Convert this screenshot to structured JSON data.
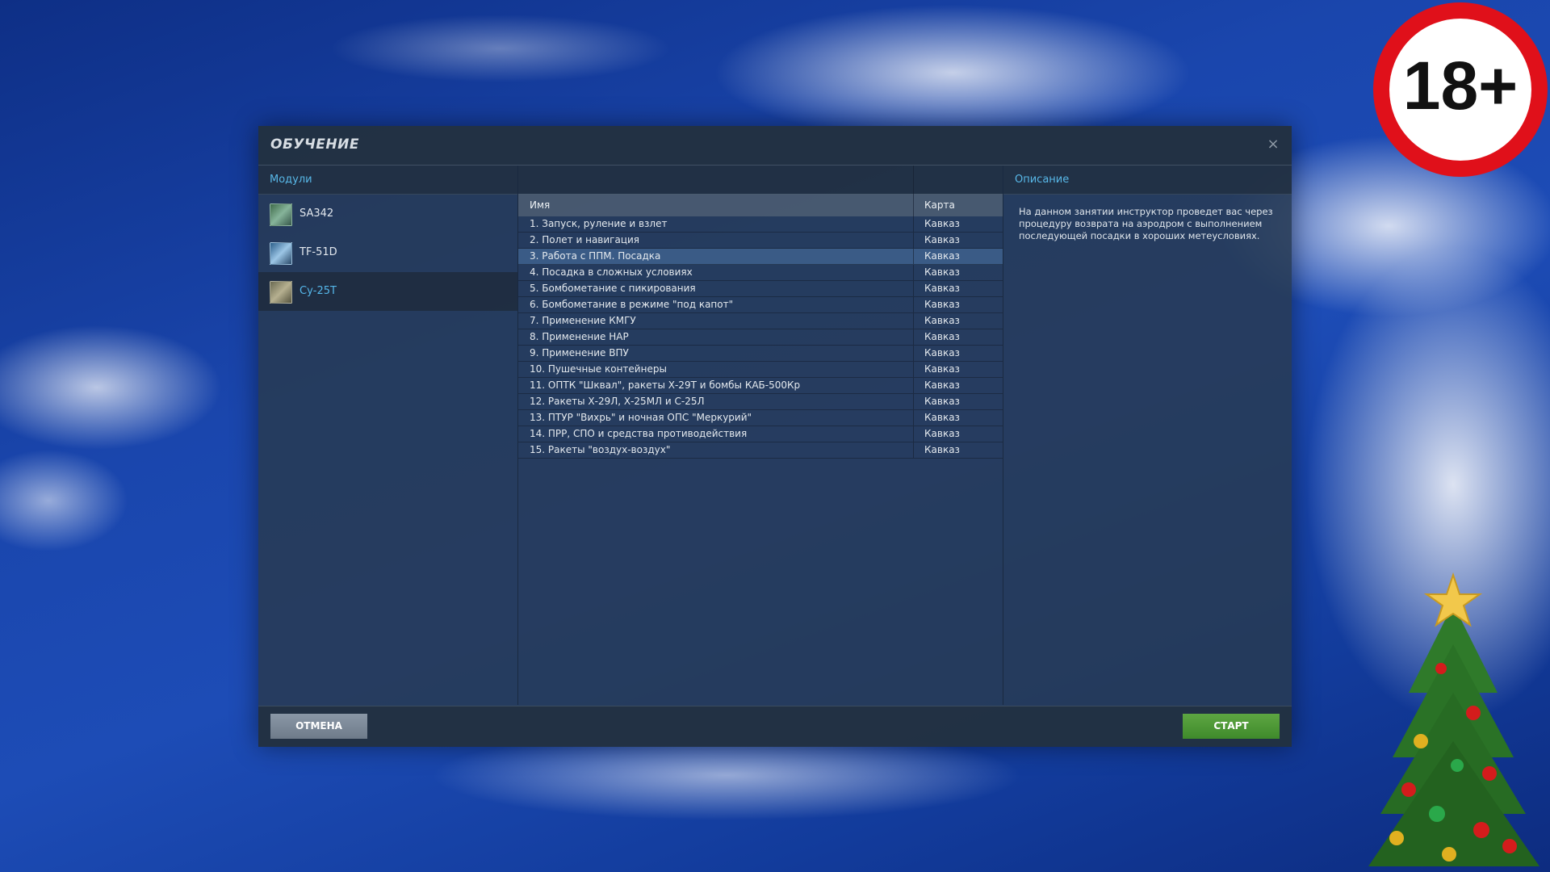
{
  "dialog": {
    "title": "ОБУЧЕНИЕ",
    "close_glyph": "×"
  },
  "modules": {
    "header": "Модули",
    "items": [
      {
        "label": "SA342",
        "icon": "sa342-module-icon",
        "selected": false
      },
      {
        "label": "TF-51D",
        "icon": "tf51d-module-icon",
        "selected": false
      },
      {
        "label": "Су-25Т",
        "icon": "su25t-module-icon",
        "selected": true
      }
    ]
  },
  "missions": {
    "columns": {
      "name": "Имя",
      "map": "Карта"
    },
    "rows": [
      {
        "name": "1. Запуск, руление и взлет",
        "map": "Кавказ"
      },
      {
        "name": "2. Полет и навигация",
        "map": "Кавказ"
      },
      {
        "name": "3. Работа с ППМ. Посадка",
        "map": "Кавказ"
      },
      {
        "name": "4. Посадка в сложных условиях",
        "map": "Кавказ"
      },
      {
        "name": "5. Бомбометание с пикирования",
        "map": "Кавказ"
      },
      {
        "name": "6. Бомбометание в режиме \"под капот\"",
        "map": "Кавказ"
      },
      {
        "name": "7. Применение КМГУ",
        "map": "Кавказ"
      },
      {
        "name": "8. Применение НАР",
        "map": "Кавказ"
      },
      {
        "name": "9. Применение ВПУ",
        "map": "Кавказ"
      },
      {
        "name": "10. Пушечные контейнеры",
        "map": "Кавказ"
      },
      {
        "name": "11. ОПТК \"Шквал\", ракеты Х-29Т и бомбы КАБ-500Кр",
        "map": "Кавказ"
      },
      {
        "name": "12. Ракеты Х-29Л, Х-25МЛ и С-25Л",
        "map": "Кавказ"
      },
      {
        "name": "13. ПТУР \"Вихрь\" и ночная ОПС \"Меркурий\"",
        "map": "Кавказ"
      },
      {
        "name": "14. ПРР, СПО и средства противодействия",
        "map": "Кавказ"
      },
      {
        "name": "15. Ракеты \"воздух-воздух\"",
        "map": "Кавказ"
      }
    ],
    "selected_index": 2
  },
  "description": {
    "header": "Описание",
    "text": "На данном занятии инструктор проведет вас через процедуру возврата на аэродром с выполнением последующей посадки в хороших метеусловиях."
  },
  "footer": {
    "cancel_label": "ОТМЕНА",
    "start_label": "СТАРТ"
  },
  "overlay": {
    "age_badge": "18+"
  },
  "colors": {
    "accent_text": "#55b7ea",
    "selected_row": "#3a5b86",
    "start_button": "#4f9a38",
    "cancel_button": "#7d8a99",
    "badge_ring": "#e0101a"
  }
}
